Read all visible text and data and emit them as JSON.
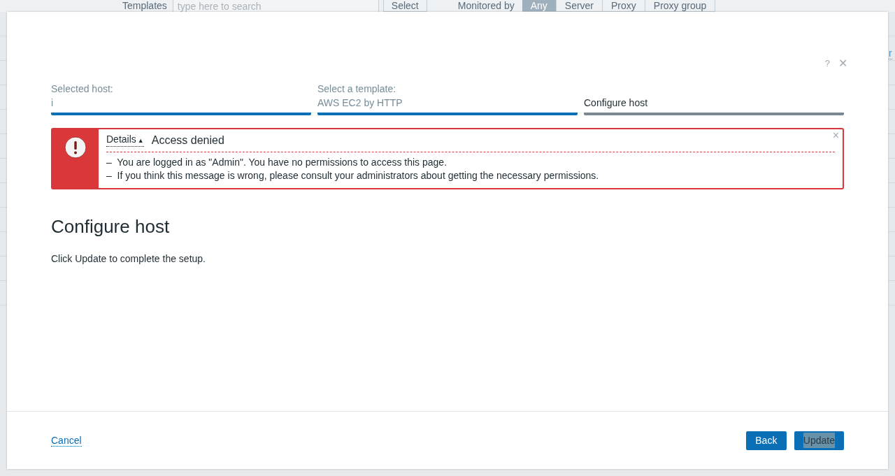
{
  "background": {
    "templates_label": "Templates",
    "search": {
      "placeholder": "type here to search"
    },
    "select_button": "Select",
    "monitored_by_label": "Monitored by",
    "monitored_by": [
      {
        "label": "Any",
        "selected": true
      },
      {
        "label": "Server",
        "selected": false
      },
      {
        "label": "Proxy",
        "selected": false
      },
      {
        "label": "Proxy group",
        "selected": false
      }
    ],
    "edge_link": "r"
  },
  "dialog": {
    "help": "?",
    "close": "✕",
    "steps": [
      {
        "label": "Selected host:",
        "value": "i",
        "selected": false
      },
      {
        "label": "Select a template:",
        "value": "AWS EC2 by HTTP",
        "selected": false
      },
      {
        "label": "Configure host",
        "selected": true
      }
    ],
    "error": {
      "details": "Details",
      "details_marker": "▲",
      "expanded": true,
      "title": "Access denied",
      "close": "×",
      "messages": [
        "–  You are logged in as \"Admin\". You have no permissions to access this page.",
        "–  If you think this message is wrong, please consult your administrators about getting the necessary permissions."
      ]
    },
    "heading": "Configure host",
    "text": "Click Update to complete the setup.",
    "cancel": "Cancel",
    "buttons": [
      "Back",
      "Update"
    ]
  }
}
